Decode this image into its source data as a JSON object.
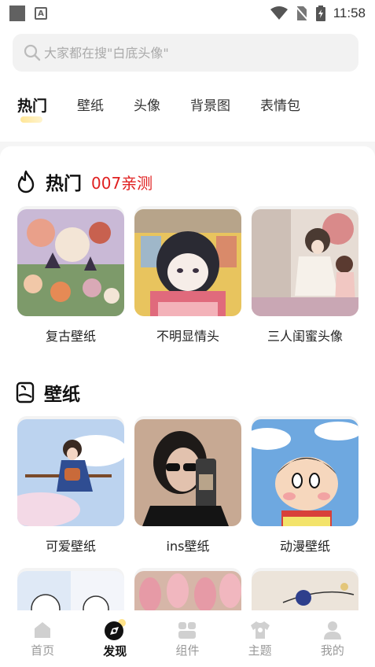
{
  "status_bar": {
    "time": "11:58"
  },
  "search": {
    "placeholder": "大家都在搜\"白底头像\""
  },
  "tabs": [
    {
      "label": "热门",
      "active": true
    },
    {
      "label": "壁纸",
      "active": false
    },
    {
      "label": "头像",
      "active": false
    },
    {
      "label": "背景图",
      "active": false
    },
    {
      "label": "表情包",
      "active": false
    }
  ],
  "sections": {
    "hot": {
      "title": "热门",
      "subtitle": "007亲测",
      "icon": "flame-icon",
      "items": [
        {
          "label": "复古壁纸"
        },
        {
          "label": "不明显情头"
        },
        {
          "label": "三人闺蜜头像"
        }
      ]
    },
    "wallpaper": {
      "title": "壁纸",
      "icon": "wallpaper-icon",
      "items": [
        {
          "label": "可爱壁纸"
        },
        {
          "label": "ins壁纸"
        },
        {
          "label": "动漫壁纸"
        }
      ]
    }
  },
  "bottom_nav": [
    {
      "label": "首页",
      "icon": "home-icon",
      "active": false
    },
    {
      "label": "发现",
      "icon": "discover-icon",
      "active": true
    },
    {
      "label": "组件",
      "icon": "widgets-icon",
      "active": false
    },
    {
      "label": "主题",
      "icon": "theme-shirt-icon",
      "active": false
    },
    {
      "label": "我的",
      "icon": "profile-icon",
      "active": false
    }
  ],
  "colors": {
    "accent_red": "#e02020",
    "tab_underline": "#ffe38a",
    "background": "#f5f5f5"
  }
}
